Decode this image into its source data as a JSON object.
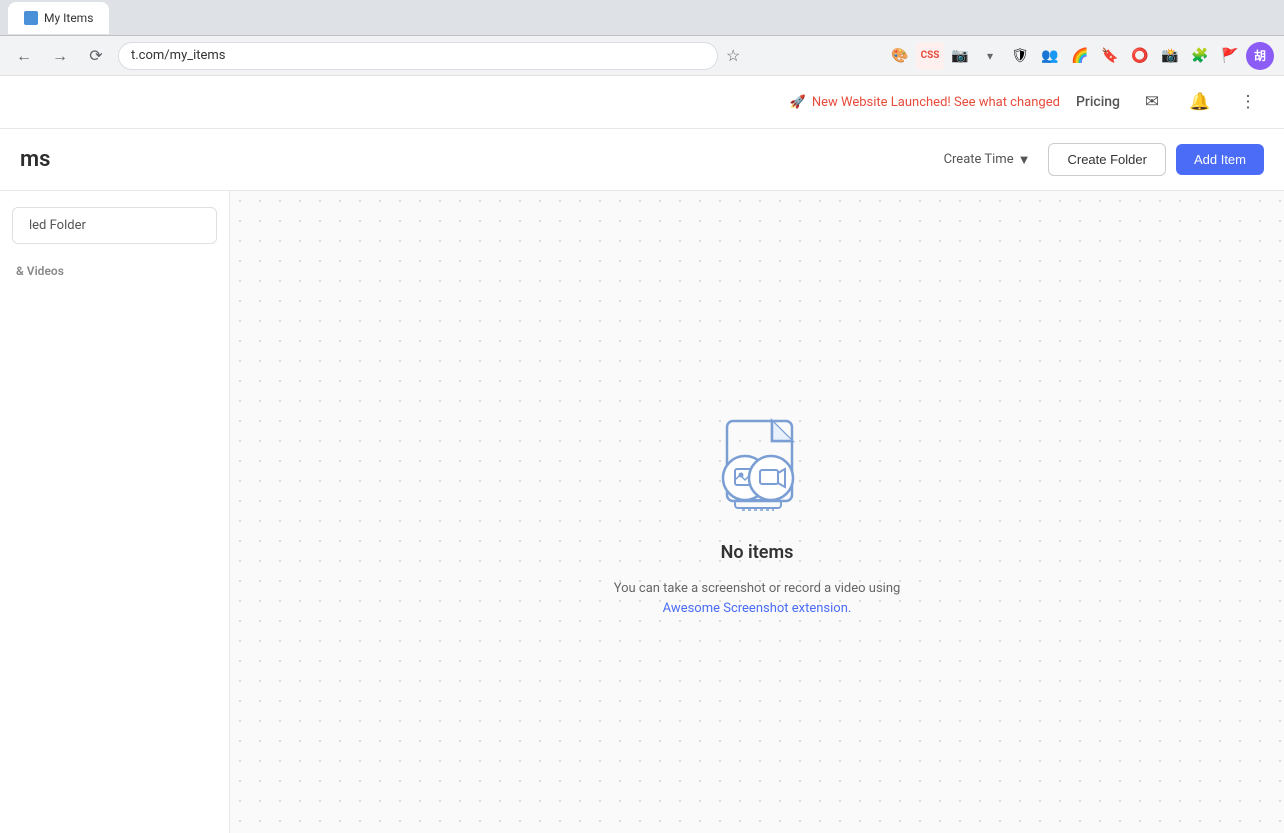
{
  "browser": {
    "url": "t.com/my_items",
    "tab_title": "My Items"
  },
  "announcement": {
    "rocket_emoji": "🚀",
    "text": "New Website Launched! See what changed",
    "pricing_label": "Pricing",
    "message_icon": "✉",
    "bell_icon": "🔔",
    "menu_icon": "⋮"
  },
  "header": {
    "title": "ms",
    "sort_label": "Create Time",
    "sort_icon": "▼",
    "create_folder_label": "Create Folder",
    "add_item_label": "Add Item"
  },
  "sidebar": {
    "folder_label": "led Folder",
    "section_label": "& Videos"
  },
  "empty_state": {
    "title": "No items",
    "description_part1": "You can take a screenshot or record a video using",
    "description_part2": "Awesome Screenshot extension."
  },
  "extensions": [
    {
      "name": "colorful-icon",
      "symbol": "🎨"
    },
    {
      "name": "css-icon",
      "symbol": "C"
    },
    {
      "name": "photo-icon",
      "symbol": "📷"
    },
    {
      "name": "dropdown-icon",
      "symbol": "▾"
    },
    {
      "name": "shield-icon",
      "symbol": "🛡"
    },
    {
      "name": "people-icon",
      "symbol": "👥"
    },
    {
      "name": "rainbow-icon",
      "symbol": "🌈"
    },
    {
      "name": "bookmark-icon",
      "symbol": "🔖"
    },
    {
      "name": "circle-icon",
      "symbol": "⭕"
    },
    {
      "name": "camera-icon",
      "symbol": "📸"
    },
    {
      "name": "puzzle-icon",
      "symbol": "🧩"
    },
    {
      "name": "flag-icon",
      "symbol": "🚩"
    }
  ],
  "profile": {
    "initials": "胡"
  }
}
